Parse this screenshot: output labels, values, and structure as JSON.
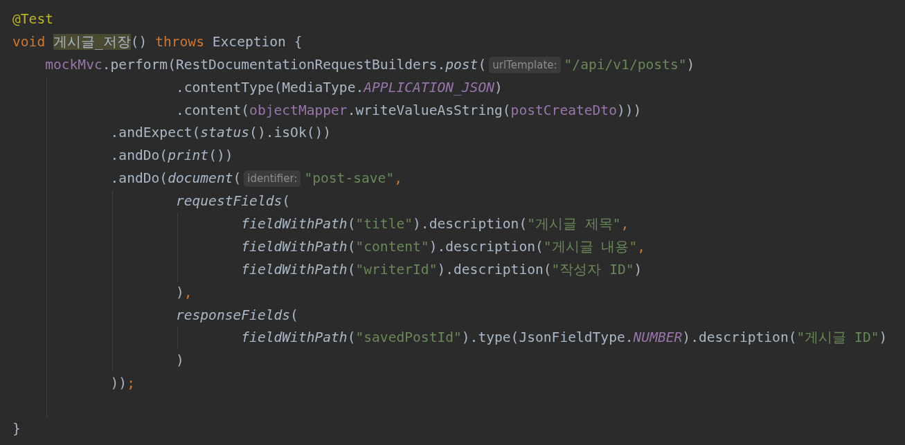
{
  "editor": {
    "lines": [
      {
        "kind": "code",
        "tokens": [
          {
            "kind": "annotation",
            "text": "@Test"
          }
        ]
      },
      {
        "kind": "code",
        "tokens": [
          {
            "kind": "keyword",
            "text": "void "
          },
          {
            "kind": "decl",
            "text": "게시글_저장"
          },
          {
            "kind": "plain",
            "text": "() "
          },
          {
            "kind": "keyword",
            "text": "throws "
          },
          {
            "kind": "plain",
            "text": "Exception {"
          }
        ]
      },
      {
        "kind": "code",
        "tokens": [
          {
            "kind": "field",
            "text": "    mockMvc"
          },
          {
            "kind": "plain",
            "text": ".perform(RestDocumentationRequestBuilders."
          },
          {
            "kind": "static",
            "text": "post"
          },
          {
            "kind": "plain",
            "text": "("
          },
          {
            "kind": "hint",
            "text": "urlTemplate:"
          },
          {
            "kind": "string",
            "text": "\"/api/v1/posts\""
          },
          {
            "kind": "plain",
            "text": ")"
          }
        ]
      },
      {
        "kind": "code",
        "tokens": [
          {
            "kind": "plain",
            "text": "                    .contentType(MediaType."
          },
          {
            "kind": "constant",
            "text": "APPLICATION_JSON"
          },
          {
            "kind": "plain",
            "text": ")"
          }
        ]
      },
      {
        "kind": "code",
        "tokens": [
          {
            "kind": "plain",
            "text": "                    .content("
          },
          {
            "kind": "field",
            "text": "objectMapper"
          },
          {
            "kind": "plain",
            "text": ".writeValueAsString("
          },
          {
            "kind": "field",
            "text": "postCreateDto"
          },
          {
            "kind": "plain",
            "text": ")))"
          }
        ]
      },
      {
        "kind": "code",
        "tokens": [
          {
            "kind": "plain",
            "text": "            .andExpect("
          },
          {
            "kind": "static",
            "text": "status"
          },
          {
            "kind": "plain",
            "text": "().isOk())"
          }
        ]
      },
      {
        "kind": "code",
        "tokens": [
          {
            "kind": "plain",
            "text": "            .andDo("
          },
          {
            "kind": "static",
            "text": "print"
          },
          {
            "kind": "plain",
            "text": "())"
          }
        ]
      },
      {
        "kind": "code",
        "tokens": [
          {
            "kind": "plain",
            "text": "            .andDo("
          },
          {
            "kind": "static",
            "text": "document"
          },
          {
            "kind": "plain",
            "text": "("
          },
          {
            "kind": "hint",
            "text": "identifier:"
          },
          {
            "kind": "string",
            "text": "\"post-save\""
          },
          {
            "kind": "punct",
            "text": ","
          }
        ]
      },
      {
        "kind": "code",
        "tokens": [
          {
            "kind": "static",
            "text": "                    requestFields"
          },
          {
            "kind": "plain",
            "text": "("
          }
        ]
      },
      {
        "kind": "code",
        "tokens": [
          {
            "kind": "static",
            "text": "                            fieldWithPath"
          },
          {
            "kind": "plain",
            "text": "("
          },
          {
            "kind": "string",
            "text": "\"title\""
          },
          {
            "kind": "plain",
            "text": ").description("
          },
          {
            "kind": "string",
            "text": "\"게시글 제목\""
          },
          {
            "kind": "punct",
            "text": ","
          }
        ]
      },
      {
        "kind": "code",
        "tokens": [
          {
            "kind": "static",
            "text": "                            fieldWithPath"
          },
          {
            "kind": "plain",
            "text": "("
          },
          {
            "kind": "string",
            "text": "\"content\""
          },
          {
            "kind": "plain",
            "text": ").description("
          },
          {
            "kind": "string",
            "text": "\"게시글 내용\""
          },
          {
            "kind": "punct",
            "text": ","
          }
        ]
      },
      {
        "kind": "code",
        "tokens": [
          {
            "kind": "static",
            "text": "                            fieldWithPath"
          },
          {
            "kind": "plain",
            "text": "("
          },
          {
            "kind": "string",
            "text": "\"writerId\""
          },
          {
            "kind": "plain",
            "text": ").description("
          },
          {
            "kind": "string",
            "text": "\"작성자 ID\""
          },
          {
            "kind": "plain",
            "text": ")"
          }
        ]
      },
      {
        "kind": "code",
        "tokens": [
          {
            "kind": "plain",
            "text": "                    )"
          },
          {
            "kind": "punct",
            "text": ","
          }
        ]
      },
      {
        "kind": "code",
        "tokens": [
          {
            "kind": "static",
            "text": "                    responseFields"
          },
          {
            "kind": "plain",
            "text": "("
          }
        ]
      },
      {
        "kind": "code",
        "tokens": [
          {
            "kind": "static",
            "text": "                            fieldWithPath"
          },
          {
            "kind": "plain",
            "text": "("
          },
          {
            "kind": "string",
            "text": "\"savedPostId\""
          },
          {
            "kind": "plain",
            "text": ").type(JsonFieldType."
          },
          {
            "kind": "constant",
            "text": "NUMBER"
          },
          {
            "kind": "plain",
            "text": ").description("
          },
          {
            "kind": "string",
            "text": "\"게시글 ID\""
          },
          {
            "kind": "plain",
            "text": ")"
          }
        ]
      },
      {
        "kind": "code",
        "tokens": [
          {
            "kind": "plain",
            "text": "                    )"
          }
        ]
      },
      {
        "kind": "code",
        "tokens": [
          {
            "kind": "plain",
            "text": "            ))"
          },
          {
            "kind": "punct",
            "text": ";"
          }
        ]
      },
      {
        "kind": "blank"
      },
      {
        "kind": "code",
        "tokens": [
          {
            "kind": "plain",
            "text": "}"
          }
        ]
      }
    ]
  }
}
